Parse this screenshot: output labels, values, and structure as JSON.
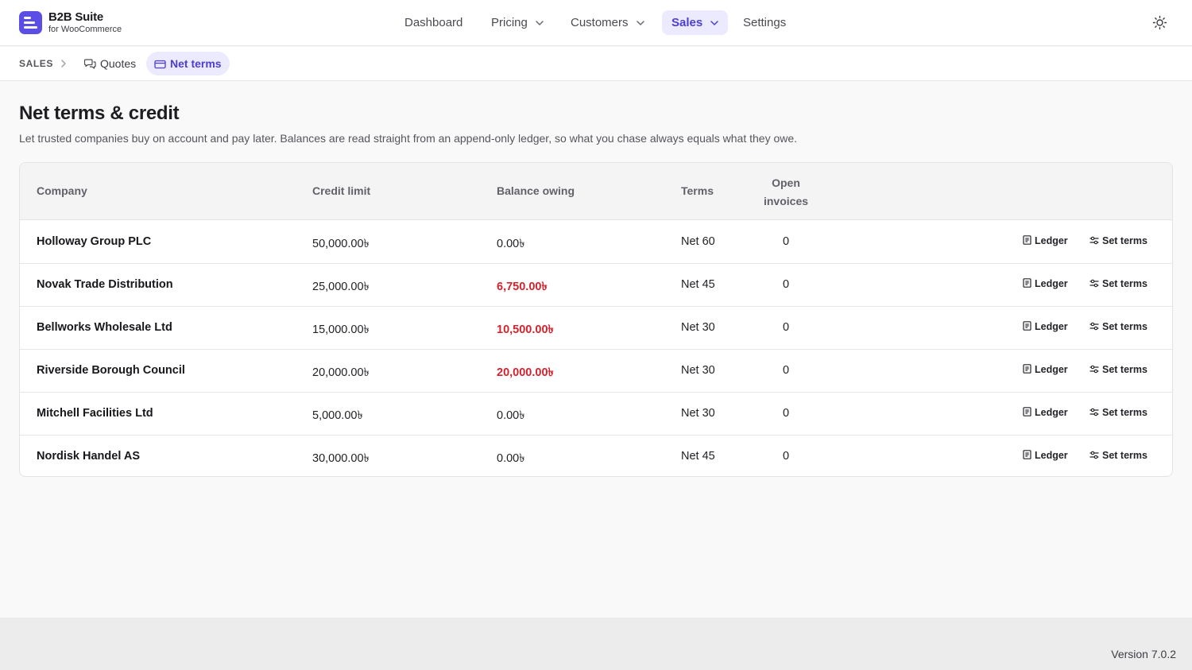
{
  "app": {
    "name": "B2B Suite",
    "subtitle": "for WooCommerce",
    "accent_color": "#5b4ee6"
  },
  "nav": {
    "items": [
      {
        "label": "Dashboard",
        "has_dropdown": false,
        "active": false
      },
      {
        "label": "Pricing",
        "has_dropdown": true,
        "active": false
      },
      {
        "label": "Customers",
        "has_dropdown": true,
        "active": false
      },
      {
        "label": "Sales",
        "has_dropdown": true,
        "active": true
      },
      {
        "label": "Settings",
        "has_dropdown": false,
        "active": false
      }
    ],
    "theme_toggle_icon": "sun-icon"
  },
  "breadcrumb": {
    "root": "SALES",
    "items": [
      {
        "label": "Quotes",
        "icon": "chat-bubbles-icon",
        "active": false
      },
      {
        "label": "Net terms",
        "icon": "credit-card-icon",
        "active": true
      }
    ]
  },
  "page": {
    "title": "Net terms & credit",
    "description": "Let trusted companies buy on account and pay later. Balances are read straight from an append-only ledger, so what you chase always equals what they owe."
  },
  "table": {
    "columns": {
      "company": "Company",
      "credit_limit": "Credit limit",
      "balance_owing": "Balance owing",
      "terms": "Terms",
      "open_invoices_line1": "Open",
      "open_invoices_line2": "invoices"
    },
    "action_labels": {
      "ledger": "Ledger",
      "set_terms": "Set terms"
    },
    "owing_color": "#d3242e",
    "rows": [
      {
        "company": "Holloway Group PLC",
        "credit_limit": "50,000.00৳",
        "balance_owing": "0.00৳",
        "owing": false,
        "terms": "Net 60",
        "open_invoices": "0"
      },
      {
        "company": "Novak Trade Distribution",
        "credit_limit": "25,000.00৳",
        "balance_owing": "6,750.00৳",
        "owing": true,
        "terms": "Net 45",
        "open_invoices": "0"
      },
      {
        "company": "Bellworks Wholesale Ltd",
        "credit_limit": "15,000.00৳",
        "balance_owing": "10,500.00৳",
        "owing": true,
        "terms": "Net 30",
        "open_invoices": "0"
      },
      {
        "company": "Riverside Borough Council",
        "credit_limit": "20,000.00৳",
        "balance_owing": "20,000.00৳",
        "owing": true,
        "terms": "Net 30",
        "open_invoices": "0"
      },
      {
        "company": "Mitchell Facilities Ltd",
        "credit_limit": "5,000.00৳",
        "balance_owing": "0.00৳",
        "owing": false,
        "terms": "Net 30",
        "open_invoices": "0"
      },
      {
        "company": "Nordisk Handel AS",
        "credit_limit": "30,000.00৳",
        "balance_owing": "0.00৳",
        "owing": false,
        "terms": "Net 45",
        "open_invoices": "0"
      }
    ]
  },
  "footer": {
    "version": "Version 7.0.2"
  }
}
